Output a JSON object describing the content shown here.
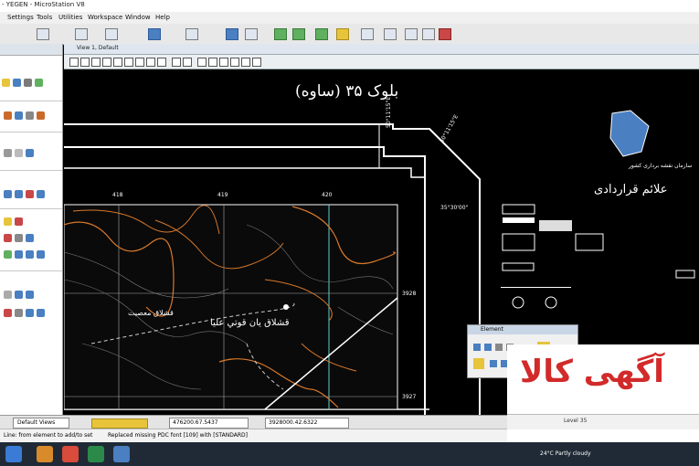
{
  "titlebar": {
    "title": "- YEGEN - MicroStation V8"
  },
  "menu": {
    "settings": "Settings",
    "tools": "Tools",
    "utilities": "Utilities",
    "workspace": "Workspace",
    "window": "Window",
    "help": "Help"
  },
  "view": {
    "title": "View 1, Default"
  },
  "map": {
    "block_title": "بلوک ۳۵ (ساوه)",
    "legend_title": "علائم قراردادی",
    "org_name": "سازمان نقشه برداری کشور",
    "grid_top": [
      "418",
      "419",
      "420"
    ],
    "grid_right": [
      "3928",
      "3927"
    ],
    "coord_vertical_1": "50°11'15\"E",
    "coord_vertical_2": "50°11'15\"E",
    "coord_right": "35°30'00\"",
    "place_name_1": "قشلاق يان قوتي عليا",
    "place_name_2": "قشلاق معصيت"
  },
  "popup": {
    "title": "Element"
  },
  "status": {
    "view_selector": "Default Views",
    "x_coord": "476200.67.5437",
    "y_coord": "3928000.42.6322",
    "prompt": "Line: from element to add/to set",
    "message": "Replaced missing PDC font [109] with [STANDARD]",
    "level": "Level 35"
  },
  "taskbar": {
    "weather": "24°C Partly cloudy"
  },
  "watermark": {
    "text": "آگهی کالا"
  }
}
